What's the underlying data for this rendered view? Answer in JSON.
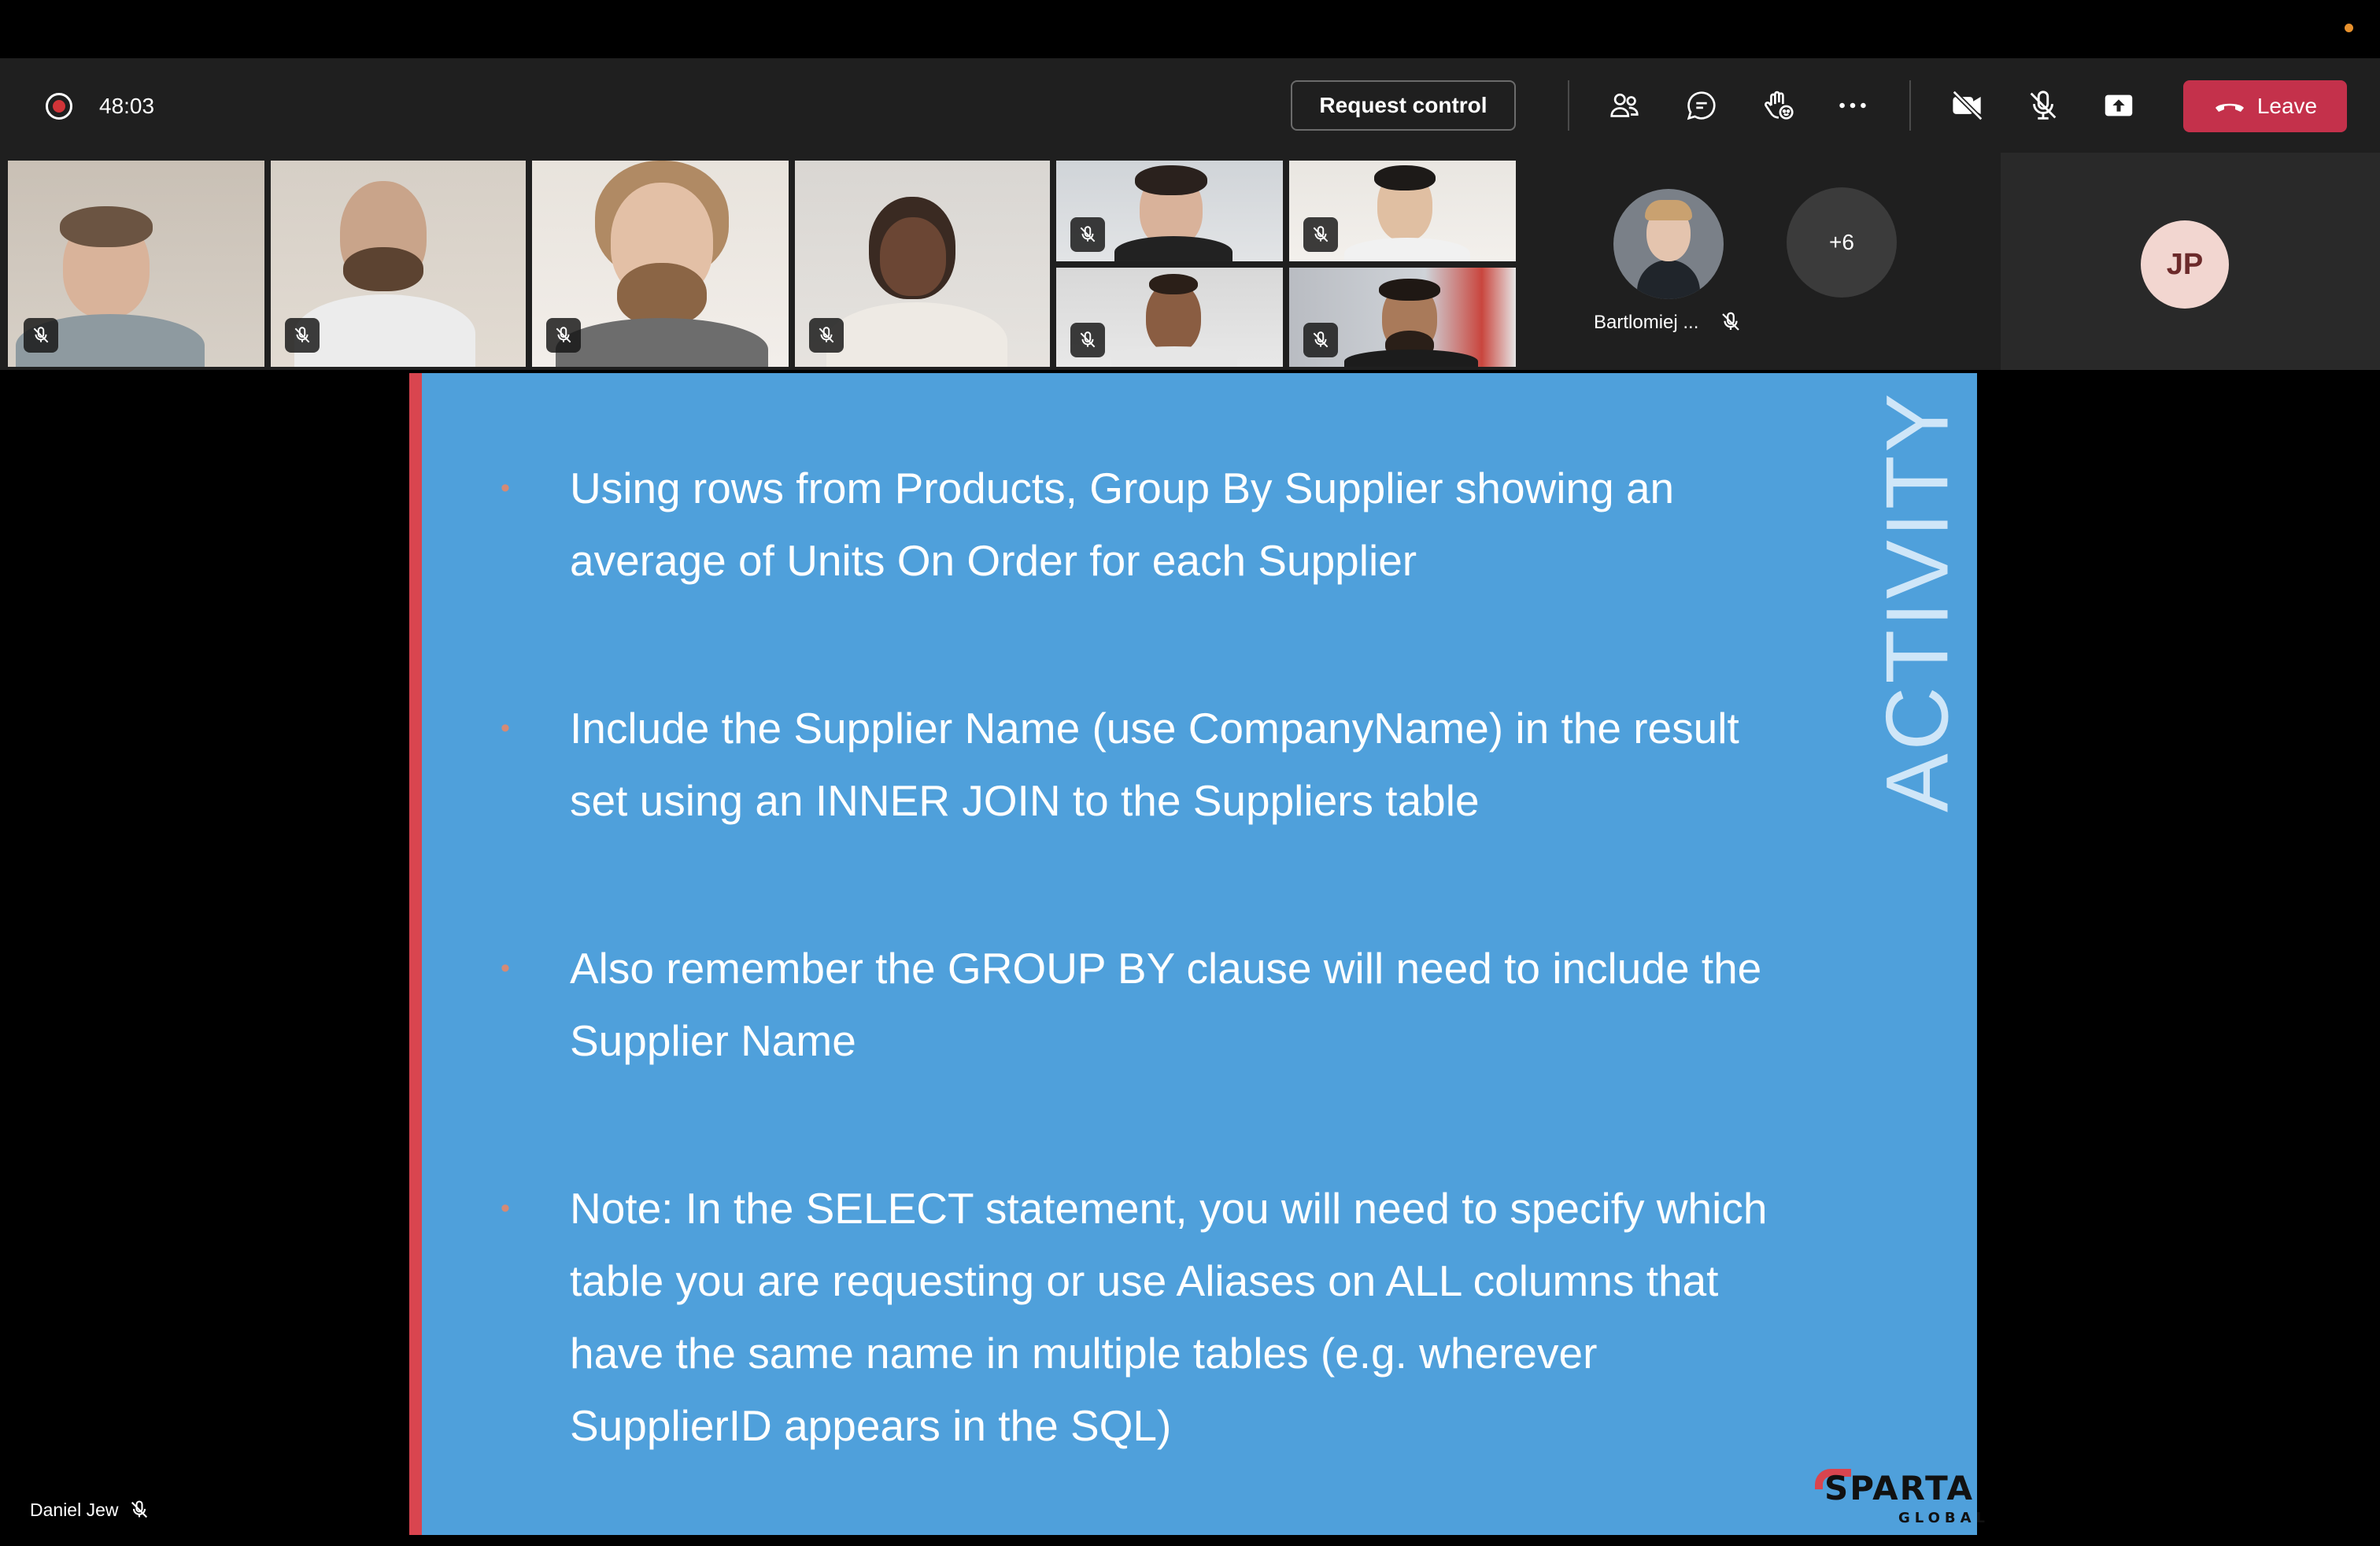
{
  "toolbar": {
    "timer": "48:03",
    "request_control_label": "Request control",
    "leave_label": "Leave",
    "icons": [
      "people-icon",
      "chat-icon",
      "raise-hand-icon",
      "more-options-icon",
      "camera-off-icon",
      "mic-off-icon",
      "share-screen-icon"
    ]
  },
  "participants": {
    "featured": {
      "name": "Bartlomiej ..."
    },
    "overflow_count": "+6",
    "self_initials": "JP"
  },
  "slide": {
    "side_title": "ACTIVITY",
    "bullets": [
      "Using rows from Products, Group By Supplier showing an average of Units On Order for each Supplier",
      "Include the Supplier Name (use CompanyName) in the result set using an INNER JOIN to the Suppliers table",
      "Also remember the GROUP BY clause will need to include the Supplier Name",
      "Note: In the SELECT statement, you will need to specify which table you are requesting or use Aliases on ALL columns that have the same name in multiple tables (e.g. wherever SupplierID appears in the SQL)"
    ],
    "logo_main": "SPARTA",
    "logo_sub": "GLOBAL"
  },
  "presenter": {
    "name": "Daniel Jew"
  },
  "colors": {
    "slide_bg": "#4fa0db",
    "slide_accent": "#d9454f",
    "leave_button": "#c4314b",
    "toolbar_bg": "#1f1f1f",
    "record_dot": "#d13438"
  }
}
